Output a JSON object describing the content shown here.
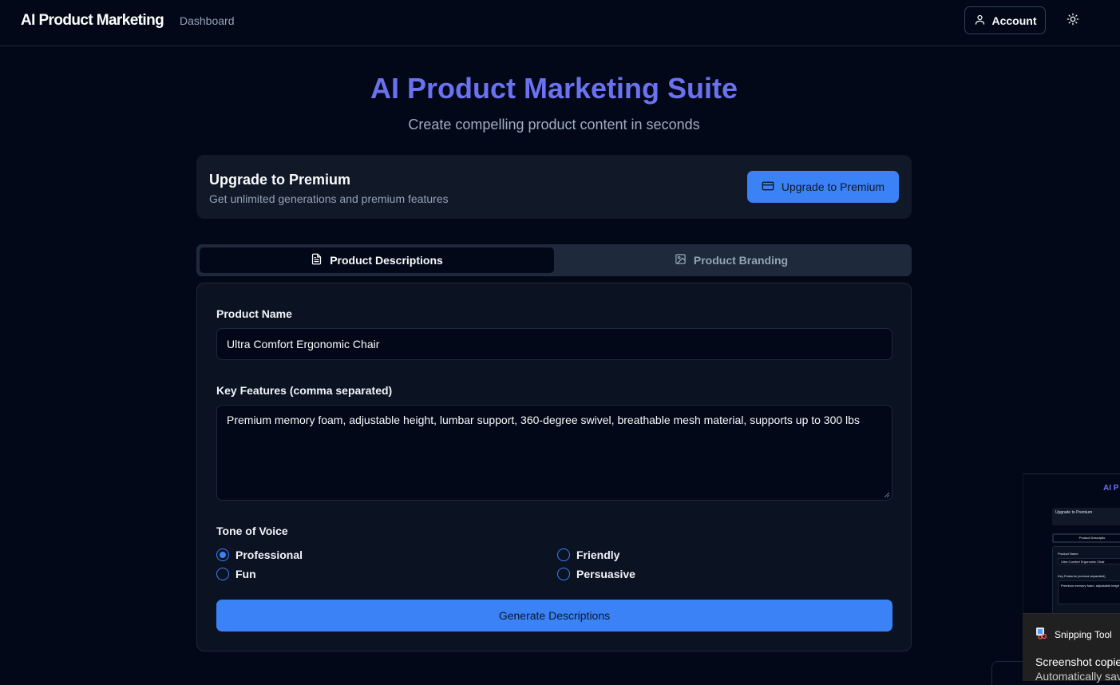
{
  "navbar": {
    "brand": "AI Product Marketing",
    "dashboard_link": "Dashboard",
    "account_label": "Account"
  },
  "hero": {
    "title": "AI Product Marketing Suite",
    "subtitle": "Create compelling product content in seconds"
  },
  "premium": {
    "title": "Upgrade to Premium",
    "subtitle": "Get unlimited generations and premium features",
    "button_label": "Upgrade to Premium"
  },
  "tabs": [
    {
      "label": "Product Descriptions",
      "active": true,
      "icon": "file-text-icon"
    },
    {
      "label": "Product Branding",
      "active": false,
      "icon": "image-icon"
    }
  ],
  "form": {
    "product_name_label": "Product Name",
    "product_name_value": "Ultra Comfort Ergonomic Chair",
    "features_label": "Key Features (comma separated)",
    "features_value": "Premium memory foam, adjustable height, lumbar support, 360-degree swivel, breathable mesh material, supports up to 300 lbs",
    "tone_label": "Tone of Voice",
    "tones": [
      {
        "label": "Professional",
        "selected": true
      },
      {
        "label": "Friendly",
        "selected": false
      },
      {
        "label": "Fun",
        "selected": false
      },
      {
        "label": "Persuasive",
        "selected": false
      }
    ],
    "generate_label": "Generate Descriptions"
  },
  "snipping": {
    "app_name": "Snipping Tool",
    "message": "Screenshot copie",
    "message2": "Automatically sav",
    "thumb_title": "AI P",
    "thumb_premium": "Upgrade to Premium",
    "thumb_tab": "Product Descriptio",
    "thumb_name_label": "Product Name",
    "thumb_name_value": "Ultra Comfort Ergonomic Chair",
    "thumb_features_label": "Key Features (comma separated)",
    "thumb_features_value": "Premium memory foam, adjustable heigh"
  },
  "colors": {
    "accent": "#3b82f6",
    "title_gradient": "#6b72f0",
    "background": "#020817"
  }
}
